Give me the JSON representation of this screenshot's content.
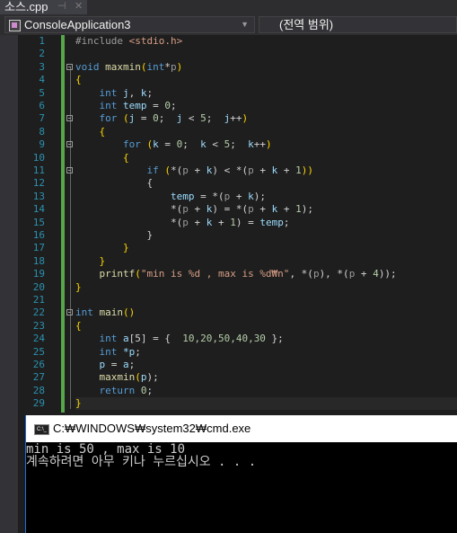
{
  "tab": {
    "label": "소스.cpp",
    "pin_icon": "pin-icon",
    "close_icon": "close-icon"
  },
  "navbar": {
    "project": "ConsoleApplication3",
    "scope": "(전역 범위)"
  },
  "code": [
    {
      "n": "1",
      "t": [
        [
          "#include ",
          "pp"
        ],
        [
          "<stdio.h>",
          "str"
        ]
      ]
    },
    {
      "n": "2",
      "t": []
    },
    {
      "n": "3",
      "fold": true,
      "t": [
        [
          "void ",
          "kw"
        ],
        [
          "maxmin",
          "fn"
        ],
        [
          "(",
          "br"
        ],
        [
          "int",
          "kw"
        ],
        [
          "*",
          "op"
        ],
        [
          "p",
          "par"
        ],
        [
          ")",
          "br"
        ]
      ]
    },
    {
      "n": "4",
      "t": [
        [
          "{",
          "br"
        ]
      ]
    },
    {
      "n": "5",
      "t": [
        [
          "    int ",
          "kw"
        ],
        [
          "j",
          "var"
        ],
        [
          ", ",
          "op"
        ],
        [
          "k",
          "var"
        ],
        [
          ";",
          "op"
        ]
      ]
    },
    {
      "n": "6",
      "t": [
        [
          "    int ",
          "kw"
        ],
        [
          "temp",
          "var"
        ],
        [
          " = ",
          "op"
        ],
        [
          "0",
          "num"
        ],
        [
          ";",
          "op"
        ]
      ]
    },
    {
      "n": "7",
      "fold": true,
      "t": [
        [
          "    for ",
          "kw"
        ],
        [
          "(",
          "br"
        ],
        [
          "j",
          "var"
        ],
        [
          " = ",
          "op"
        ],
        [
          "0",
          "num"
        ],
        [
          ";  ",
          "op"
        ],
        [
          "j",
          "var"
        ],
        [
          " < ",
          "op"
        ],
        [
          "5",
          "num"
        ],
        [
          ";  ",
          "op"
        ],
        [
          "j",
          "var"
        ],
        [
          "++",
          "op"
        ],
        [
          ")",
          "br"
        ]
      ]
    },
    {
      "n": "8",
      "t": [
        [
          "    {",
          "br"
        ]
      ]
    },
    {
      "n": "9",
      "fold": true,
      "t": [
        [
          "        for ",
          "kw"
        ],
        [
          "(",
          "br"
        ],
        [
          "k",
          "var"
        ],
        [
          " = ",
          "op"
        ],
        [
          "0",
          "num"
        ],
        [
          ";  ",
          "op"
        ],
        [
          "k",
          "var"
        ],
        [
          " < ",
          "op"
        ],
        [
          "5",
          "num"
        ],
        [
          ";  ",
          "op"
        ],
        [
          "k",
          "var"
        ],
        [
          "++",
          "op"
        ],
        [
          ")",
          "br"
        ]
      ]
    },
    {
      "n": "10",
      "t": [
        [
          "        {",
          "br"
        ]
      ]
    },
    {
      "n": "11",
      "fold": true,
      "t": [
        [
          "            if ",
          "kw"
        ],
        [
          "(",
          "br"
        ],
        [
          "*(",
          "op"
        ],
        [
          "p",
          "par"
        ],
        [
          " + ",
          "op"
        ],
        [
          "k",
          "var"
        ],
        [
          ")",
          "op"
        ],
        [
          " < *(",
          "op"
        ],
        [
          "p",
          "par"
        ],
        [
          " + ",
          "op"
        ],
        [
          "k",
          "var"
        ],
        [
          " + ",
          "op"
        ],
        [
          "1",
          "num"
        ],
        [
          "))",
          "br"
        ]
      ]
    },
    {
      "n": "12",
      "t": [
        [
          "            {",
          "op"
        ]
      ]
    },
    {
      "n": "13",
      "t": [
        [
          "                temp",
          "var"
        ],
        [
          " = *(",
          "op"
        ],
        [
          "p",
          "par"
        ],
        [
          " + ",
          "op"
        ],
        [
          "k",
          "var"
        ],
        [
          ");",
          "op"
        ]
      ]
    },
    {
      "n": "14",
      "t": [
        [
          "                *(",
          "op"
        ],
        [
          "p",
          "par"
        ],
        [
          " + ",
          "op"
        ],
        [
          "k",
          "var"
        ],
        [
          ") = *(",
          "op"
        ],
        [
          "p",
          "par"
        ],
        [
          " + ",
          "op"
        ],
        [
          "k",
          "var"
        ],
        [
          " + ",
          "op"
        ],
        [
          "1",
          "num"
        ],
        [
          ");",
          "op"
        ]
      ]
    },
    {
      "n": "15",
      "t": [
        [
          "                *(",
          "op"
        ],
        [
          "p",
          "par"
        ],
        [
          " + ",
          "op"
        ],
        [
          "k",
          "var"
        ],
        [
          " + ",
          "op"
        ],
        [
          "1",
          "num"
        ],
        [
          ") = ",
          "op"
        ],
        [
          "temp",
          "var"
        ],
        [
          ";",
          "op"
        ]
      ]
    },
    {
      "n": "16",
      "t": [
        [
          "            }",
          "op"
        ]
      ]
    },
    {
      "n": "17",
      "t": [
        [
          "        }",
          "br"
        ]
      ]
    },
    {
      "n": "18",
      "t": [
        [
          "    }",
          "br"
        ]
      ]
    },
    {
      "n": "19",
      "t": [
        [
          "    printf",
          "fn"
        ],
        [
          "(",
          "br"
        ],
        [
          "\"min is %d , max is %d₩n\"",
          "str"
        ],
        [
          ", *(",
          "op"
        ],
        [
          "p",
          "par"
        ],
        [
          "), *(",
          "op"
        ],
        [
          "p",
          "par"
        ],
        [
          " + ",
          "op"
        ],
        [
          "4",
          "num"
        ],
        [
          "));",
          "op"
        ]
      ]
    },
    {
      "n": "20",
      "t": [
        [
          "}",
          "br"
        ]
      ]
    },
    {
      "n": "21",
      "t": []
    },
    {
      "n": "22",
      "fold": true,
      "t": [
        [
          "int ",
          "kw"
        ],
        [
          "main",
          "fn"
        ],
        [
          "()",
          "br"
        ]
      ]
    },
    {
      "n": "23",
      "t": [
        [
          "{",
          "br"
        ]
      ]
    },
    {
      "n": "24",
      "t": [
        [
          "    int ",
          "kw"
        ],
        [
          "a",
          "var"
        ],
        [
          "[5] = {  ",
          "op"
        ],
        [
          "10,20,50,40,30",
          "num"
        ],
        [
          " };",
          "op"
        ]
      ]
    },
    {
      "n": "25",
      "t": [
        [
          "    int ",
          "kw"
        ],
        [
          "*p",
          "var"
        ],
        [
          ";",
          "op"
        ]
      ]
    },
    {
      "n": "26",
      "t": [
        [
          "    p",
          "var"
        ],
        [
          " = ",
          "op"
        ],
        [
          "a",
          "var"
        ],
        [
          ";",
          "op"
        ]
      ]
    },
    {
      "n": "27",
      "t": [
        [
          "    maxmin",
          "fn"
        ],
        [
          "(",
          "br"
        ],
        [
          "p",
          "var"
        ],
        [
          ");",
          "op"
        ]
      ]
    },
    {
      "n": "28",
      "t": [
        [
          "    return ",
          "kw"
        ],
        [
          "0",
          "num"
        ],
        [
          ";",
          "op"
        ]
      ]
    },
    {
      "n": "29",
      "t": [
        [
          "}",
          "br"
        ]
      ]
    }
  ],
  "console": {
    "title": "C:₩WINDOWS₩system32₩cmd.exe",
    "icon": "C:\\_",
    "lines": [
      "min is 50 , max is 10",
      "계속하려면 아무 키나 누르십시오 . . ."
    ]
  }
}
